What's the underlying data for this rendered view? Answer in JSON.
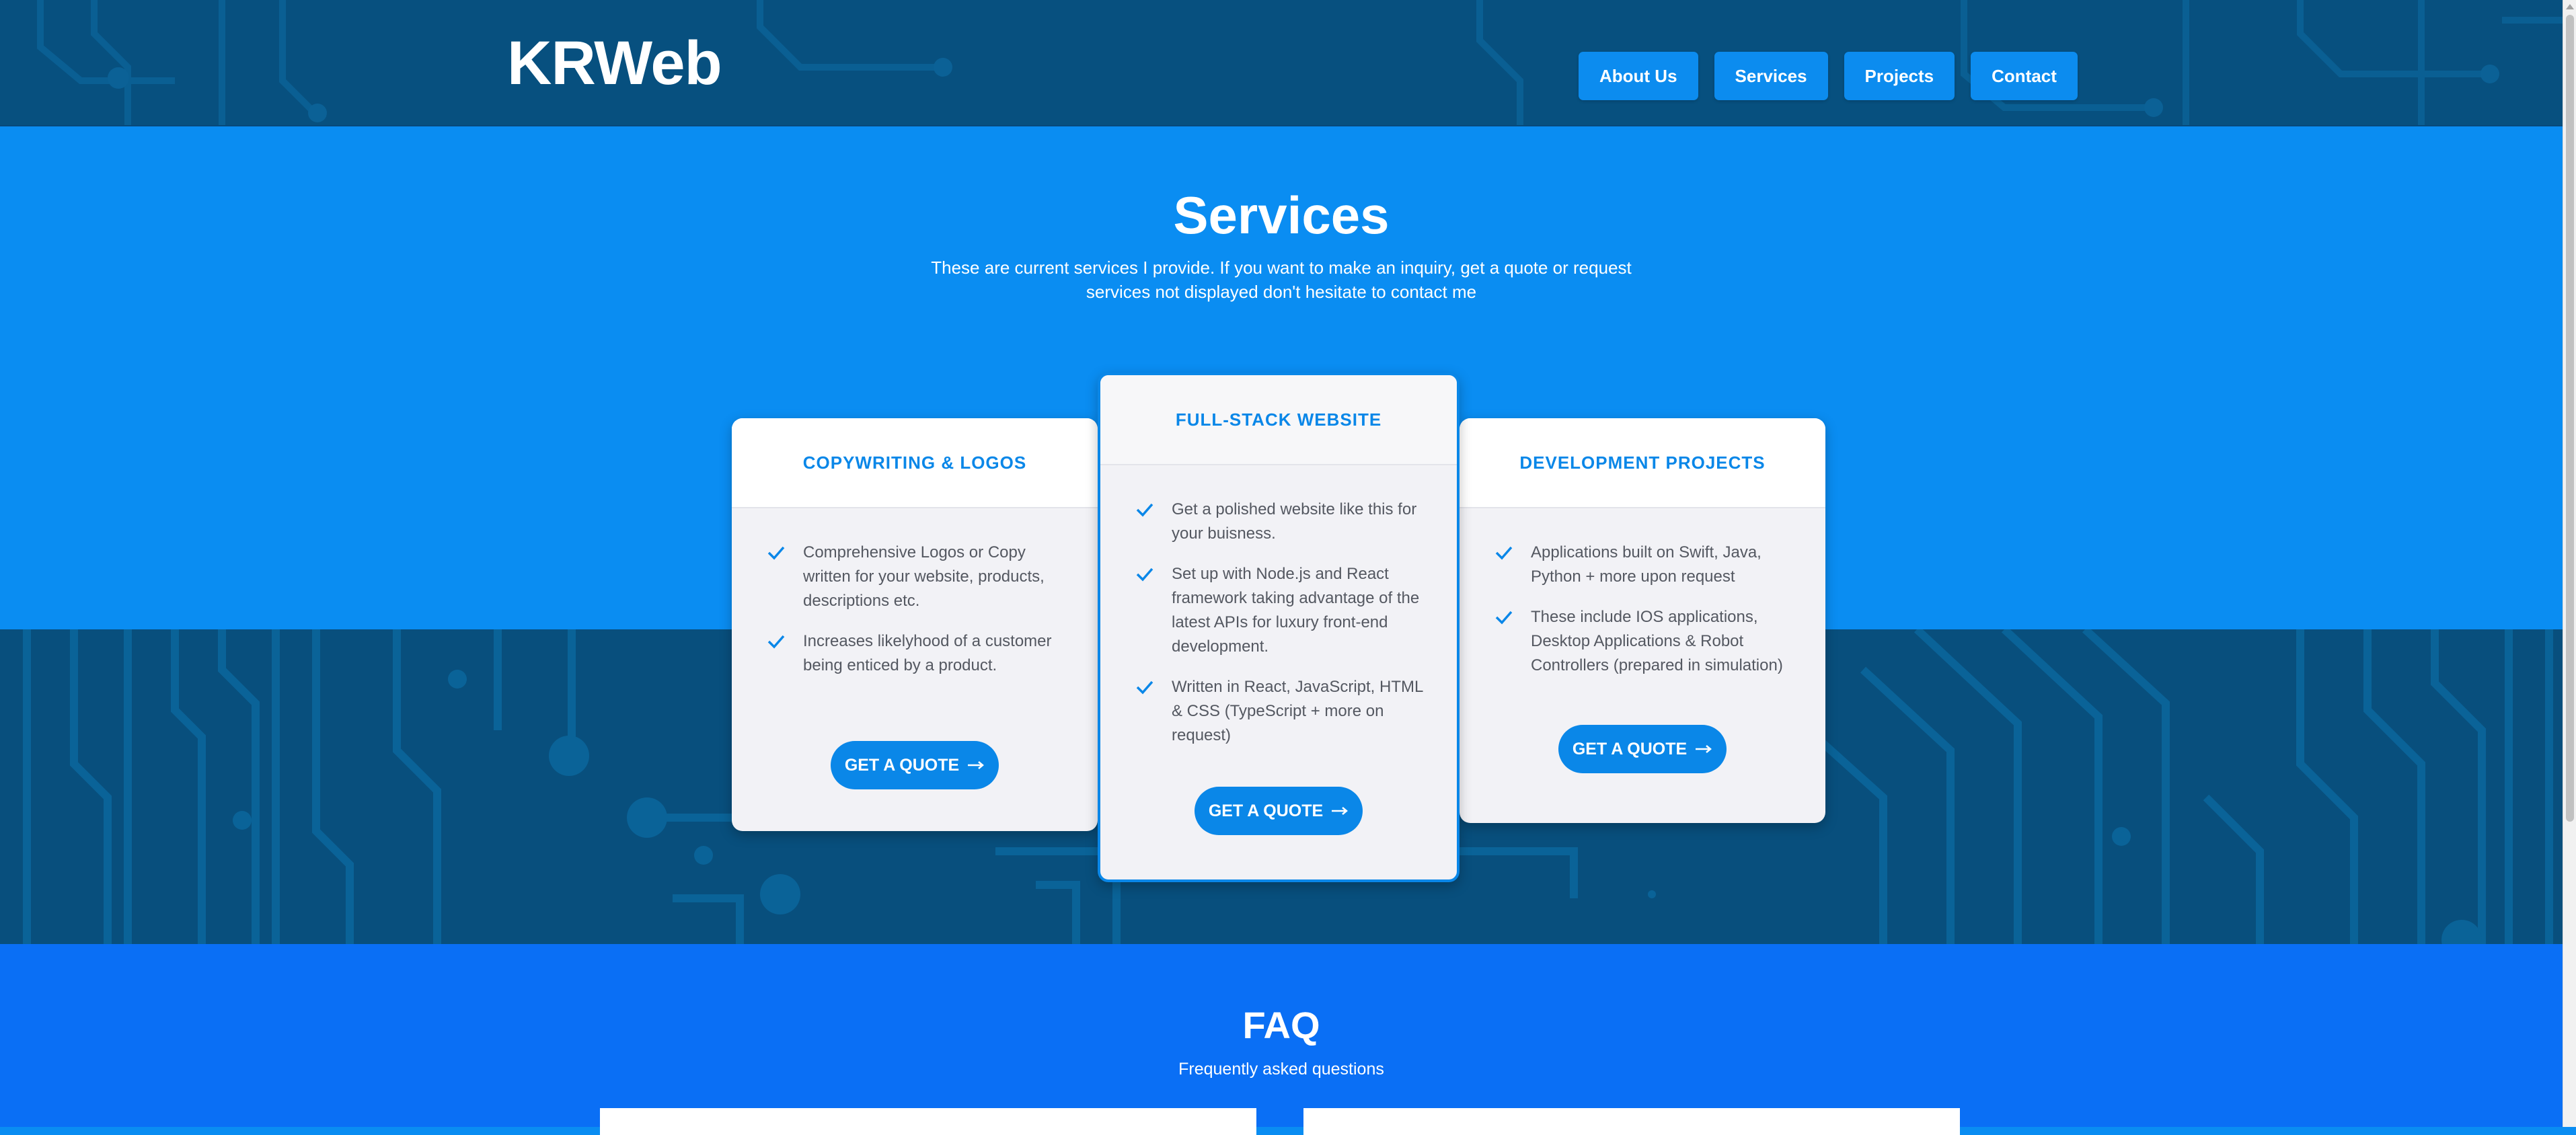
{
  "brand": {
    "logo": "KRWeb"
  },
  "nav": {
    "items": [
      "About Us",
      "Services",
      "Projects",
      "Contact"
    ]
  },
  "services": {
    "title": "Services",
    "subtitle": "These are current services I provide. If you want to make an inquiry, get a quote or request services not displayed don't hesitate to contact me",
    "cards": [
      {
        "title": "COPYWRITING & LOGOS",
        "features": [
          "Comprehensive Logos or Copy written for your website, products, descriptions etc.",
          "Increases likelyhood of a customer being enticed by a product."
        ],
        "button": "GET A QUOTE"
      },
      {
        "title": "FULL-STACK WEBSITE",
        "features": [
          "Get a polished website like this for your buisness.",
          "Set up with Node.js and React framework taking advantage of the latest APIs for luxury front-end development.",
          "Written in React, JavaScript, HTML & CSS (TypeScript + more on request)"
        ],
        "button": "GET A QUOTE"
      },
      {
        "title": "DEVELOPMENT PROJECTS",
        "features": [
          "Applications built on Swift, Java, Python + more upon request",
          "These include IOS applications, Desktop Applications & Robot Controllers (prepared in simulation)"
        ],
        "button": "GET A QUOTE"
      }
    ]
  },
  "faq": {
    "title": "FAQ",
    "subtitle": "Frequently asked questions"
  },
  "colors": {
    "header_bg": "#07507f",
    "hero_bg": "#0a8df2",
    "faq_bg": "#0a6ff5",
    "accent": "#0a87e8",
    "nav_button": "#0c8cef"
  },
  "icons": {
    "check": "check-icon",
    "arrow": "arrow-right-icon"
  }
}
